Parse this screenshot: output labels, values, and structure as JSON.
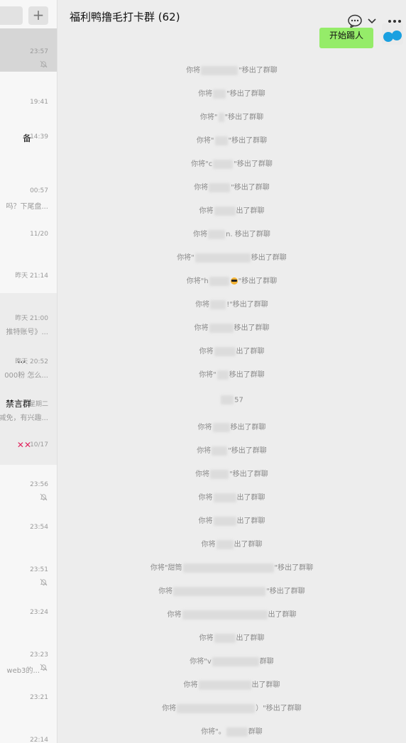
{
  "window": {
    "group_title": "福利鸭撸毛打卡群 (62)"
  },
  "sidebar": {
    "add_button": "+",
    "chats": [
      {
        "time": "23:57",
        "muted": true,
        "title": "",
        "preview": ""
      },
      {
        "time": "19:41",
        "muted": false,
        "title": "",
        "preview": ""
      },
      {
        "time": "14:39",
        "muted": false,
        "title": "备",
        "preview": ""
      },
      {
        "time": "00:57",
        "muted": false,
        "title": "",
        "preview": "吗？下尾盘..."
      },
      {
        "time": "11/20",
        "muted": false,
        "title": "",
        "preview": ""
      },
      {
        "time": "昨天 21:14",
        "muted": false,
        "title": "",
        "preview": ""
      },
      {
        "time": "昨天 21:00",
        "muted": false,
        "title": "",
        "preview": "推特账号》..."
      },
      {
        "time": "昨天 20:52",
        "muted": false,
        "title": "...",
        "preview": "000粉 怎么..."
      },
      {
        "time": "星期二",
        "muted": false,
        "title": "禁言群",
        "preview": "减免，有兴趣..."
      },
      {
        "time": "10/17",
        "muted": false,
        "title": "✕✕",
        "preview": ""
      },
      {
        "time": "23:56",
        "muted": true,
        "title": "",
        "preview": ""
      },
      {
        "time": "23:54",
        "muted": false,
        "title": "",
        "preview": ""
      },
      {
        "time": "23:51",
        "muted": true,
        "title": "",
        "preview": ""
      },
      {
        "time": "23:24",
        "muted": false,
        "title": "",
        "preview": ""
      },
      {
        "time": "23:23",
        "muted": true,
        "title": "",
        "preview": "web3的..."
      },
      {
        "time": "23:21",
        "muted": false,
        "title": "",
        "preview": ""
      },
      {
        "time": "22:14",
        "muted": false,
        "title": "",
        "preview": ""
      }
    ]
  },
  "chat": {
    "sent_message": "开始踢人",
    "notices": [
      {
        "prefix": "你将",
        "suffix": "\"移出了群聊"
      },
      {
        "prefix": "你将",
        "suffix": "\"移出了群聊"
      },
      {
        "prefix": "你将\"",
        "suffix": "\"移出了群聊"
      },
      {
        "prefix": "你将\"",
        "suffix": "\"移出了群聊"
      },
      {
        "prefix": "你将\"c",
        "suffix": "\"移出了群聊"
      },
      {
        "prefix": "你将",
        "suffix": "\"移出了群聊"
      },
      {
        "prefix": "你将",
        "suffix": "出了群聊"
      },
      {
        "prefix": "你将",
        "suffix": "n.  移出了群聊"
      },
      {
        "prefix": "你将\"",
        "suffix": "移出了群聊"
      },
      {
        "prefix": "你将\"h",
        "suffix": "\"移出了群聊"
      },
      {
        "prefix": "你将",
        "suffix": "!\"移出了群聊"
      },
      {
        "prefix": "你将",
        "suffix": "移出了群聊"
      },
      {
        "prefix": "你将",
        "suffix": "出了群聊"
      },
      {
        "prefix": "你将\"",
        "suffix": "移出了群聊"
      },
      {
        "prefix": "",
        "suffix": "57"
      },
      {
        "prefix": "你将",
        "suffix": "移出了群聊"
      },
      {
        "prefix": "你将",
        "suffix": "\"移出了群聊"
      },
      {
        "prefix": "你将",
        "suffix": "\"移出了群聊"
      },
      {
        "prefix": "你将",
        "suffix": "出了群聊"
      },
      {
        "prefix": "你将",
        "suffix": "出了群聊"
      },
      {
        "prefix": "你将",
        "suffix": "出了群聊"
      },
      {
        "prefix": "你将\"甜筒",
        "suffix": "\"移出了群聊"
      },
      {
        "prefix": "你将",
        "suffix": "\"移出了群聊"
      },
      {
        "prefix": "你将",
        "suffix": "出了群聊"
      },
      {
        "prefix": "你将",
        "suffix": "出了群聊"
      },
      {
        "prefix": "你将\"v",
        "suffix": "群聊"
      },
      {
        "prefix": "你将",
        "suffix": "出了群聊"
      },
      {
        "prefix": "你将",
        "suffix": "）\"移出了群聊"
      },
      {
        "prefix": "你将\"。",
        "suffix": "群聊"
      }
    ]
  }
}
